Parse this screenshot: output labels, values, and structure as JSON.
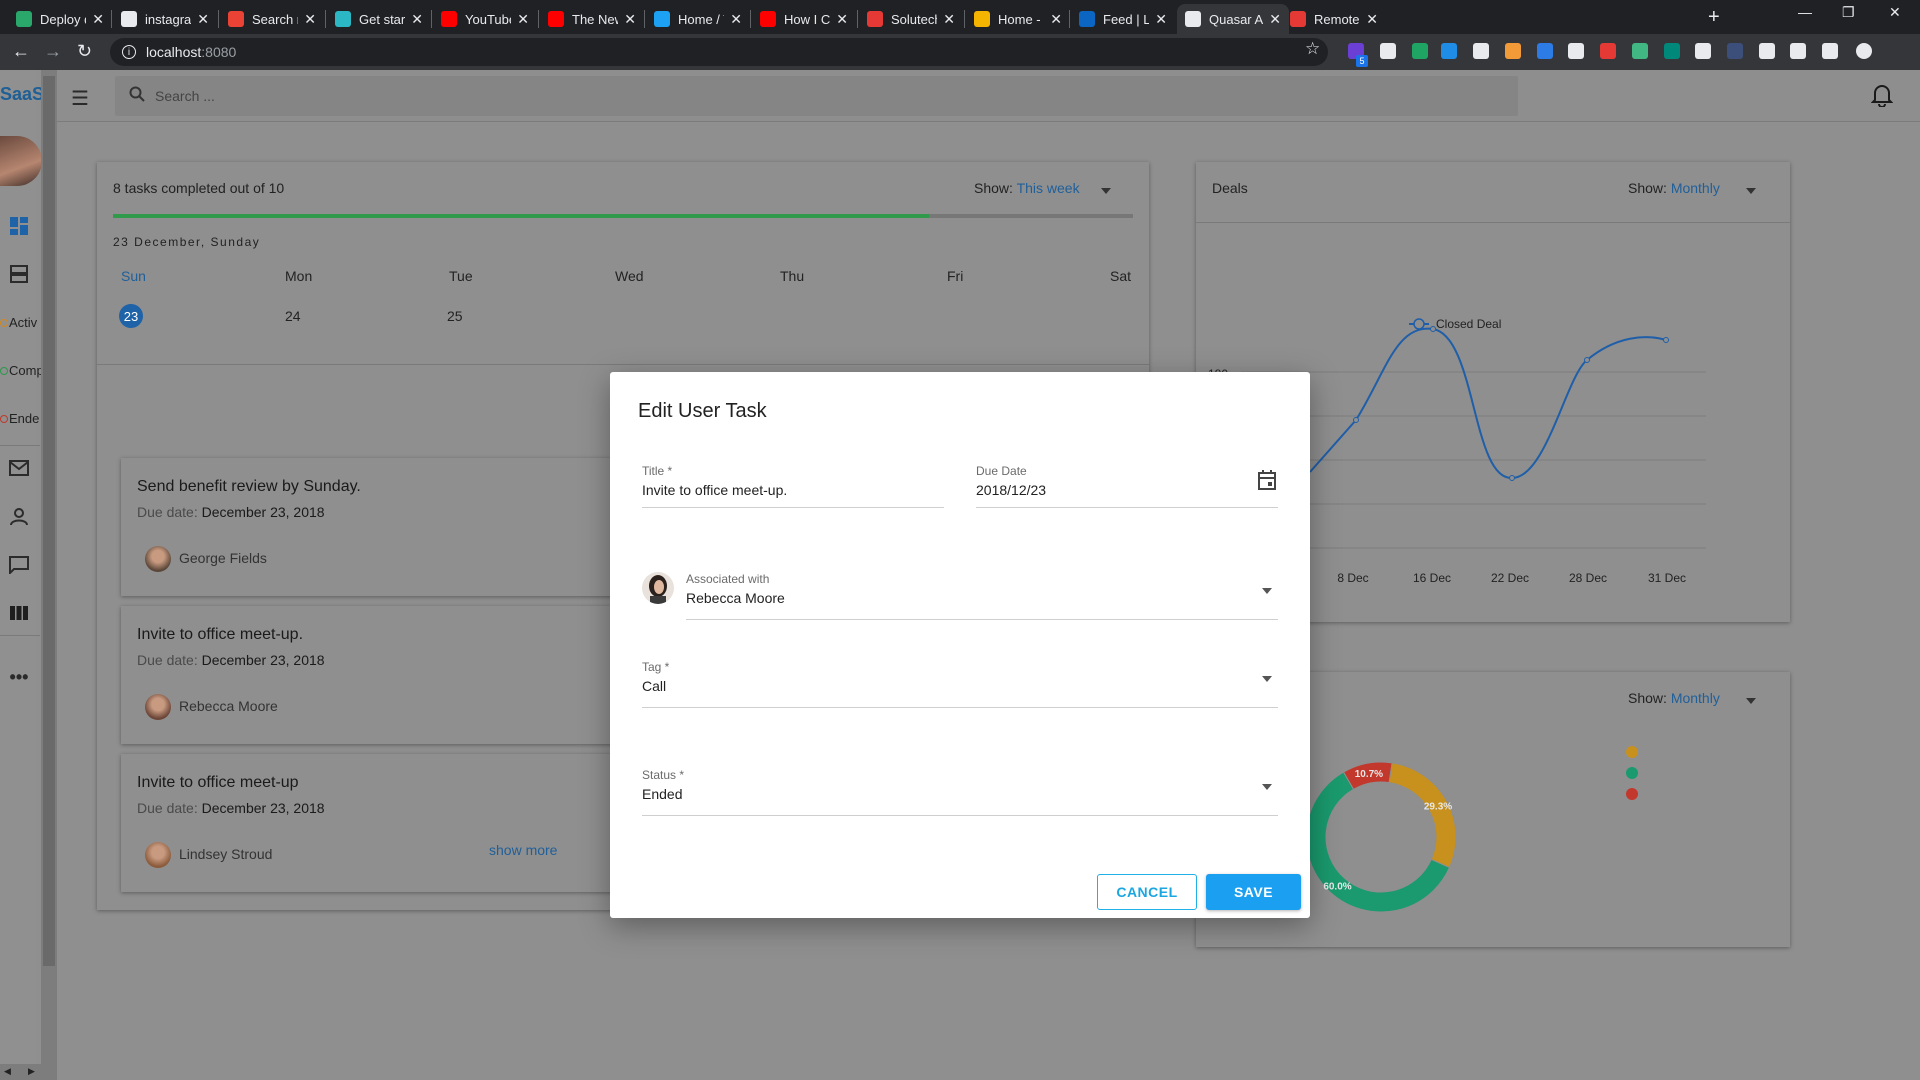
{
  "browser": {
    "tabs": [
      {
        "title": "Deploy deta",
        "color": "#2aa86b"
      },
      {
        "title": "instagram-c",
        "color": "#e8eaed"
      },
      {
        "title": "Search resul",
        "color": "#ea4335"
      },
      {
        "title": "Get started",
        "color": "#2bb7c3"
      },
      {
        "title": "YouTube",
        "color": "#ff0000"
      },
      {
        "title": "The New Me",
        "color": "#ff0000"
      },
      {
        "title": "Home / Twit",
        "color": "#1da1f2"
      },
      {
        "title": "How I Creat",
        "color": "#ff0000"
      },
      {
        "title": "Solutech Lin",
        "color": "#e53935"
      },
      {
        "title": "Home - Solu",
        "color": "#f4b400"
      },
      {
        "title": "Feed | Linke",
        "color": "#0a66c2"
      },
      {
        "title": "Quasar App",
        "color": "#e8eaed"
      },
      {
        "title": "Remote Lara",
        "color": "#e53935"
      }
    ],
    "url_host": "localhost",
    "url_port": ":8080",
    "ext_badge": "5"
  },
  "app": {
    "brand": "SaaS",
    "search_placeholder": "Search ...",
    "rail_status": [
      "Activ",
      "Comp",
      "Ende"
    ]
  },
  "tasks_card": {
    "summary": "8 tasks completed out of 10",
    "progress": 0.8,
    "show_label": "Show:",
    "show_value": "This week",
    "date_heading": "23 December, Sunday",
    "days": [
      {
        "name": "Sun",
        "num": "23"
      },
      {
        "name": "Mon",
        "num": "24"
      },
      {
        "name": "Tue",
        "num": "25"
      },
      {
        "name": "Wed",
        "num": ""
      },
      {
        "name": "Thu",
        "num": ""
      },
      {
        "name": "Fri",
        "num": ""
      },
      {
        "name": "Sat",
        "num": ""
      }
    ],
    "tasks": [
      {
        "title": "Send benefit review by Sunday.",
        "due_label": "Due date:",
        "due": "December 23, 2018",
        "person": "George Fields"
      },
      {
        "title": "Invite to office meet-up.",
        "due_label": "Due date:",
        "due": "December 23, 2018",
        "person": "Rebecca Moore"
      },
      {
        "title": "Invite to office meet-up",
        "due_label": "Due date:",
        "due": "December 23, 2018",
        "person": "Lindsey Stroud"
      }
    ],
    "show_more": "show more"
  },
  "deals_card": {
    "title": "Deals",
    "show_label": "Show:",
    "show_value": "Monthly"
  },
  "donut_card": {
    "show_label": "Show:",
    "show_value": "Monthly",
    "legend_colors": [
      "#c8901c",
      "#1a9a6e",
      "#c2382c"
    ]
  },
  "chart_data": [
    {
      "type": "line",
      "series": [
        {
          "name": "Closed Deal",
          "values": [
            null,
            null,
            180,
            null,
            null,
            null
          ]
        }
      ],
      "categories": [
        "8 Dec",
        "16 Dec",
        "22 Dec",
        "28 Dec",
        "31 Dec"
      ],
      "y_tick_labels": [
        "180"
      ],
      "line_color": "#1f5ea8"
    },
    {
      "type": "pie",
      "labels": [
        "60.0%",
        "29.3%",
        "10.7%"
      ],
      "values": [
        60.0,
        29.3,
        10.7
      ],
      "colors": [
        "#1a9a6e",
        "#c8901c",
        "#c2382c"
      ]
    }
  ],
  "dialog": {
    "title": "Edit User Task",
    "title_field": {
      "label": "Title *",
      "value": "Invite to office meet-up."
    },
    "due_field": {
      "label": "Due Date",
      "value": "2018/12/23"
    },
    "assoc_field": {
      "label": "Associated with",
      "value": "Rebecca Moore"
    },
    "tag_field": {
      "label": "Tag *",
      "value": "Call"
    },
    "status_field": {
      "label": "Status *",
      "value": "Ended"
    },
    "cancel_label": "CANCEL",
    "save_label": "SAVE"
  }
}
